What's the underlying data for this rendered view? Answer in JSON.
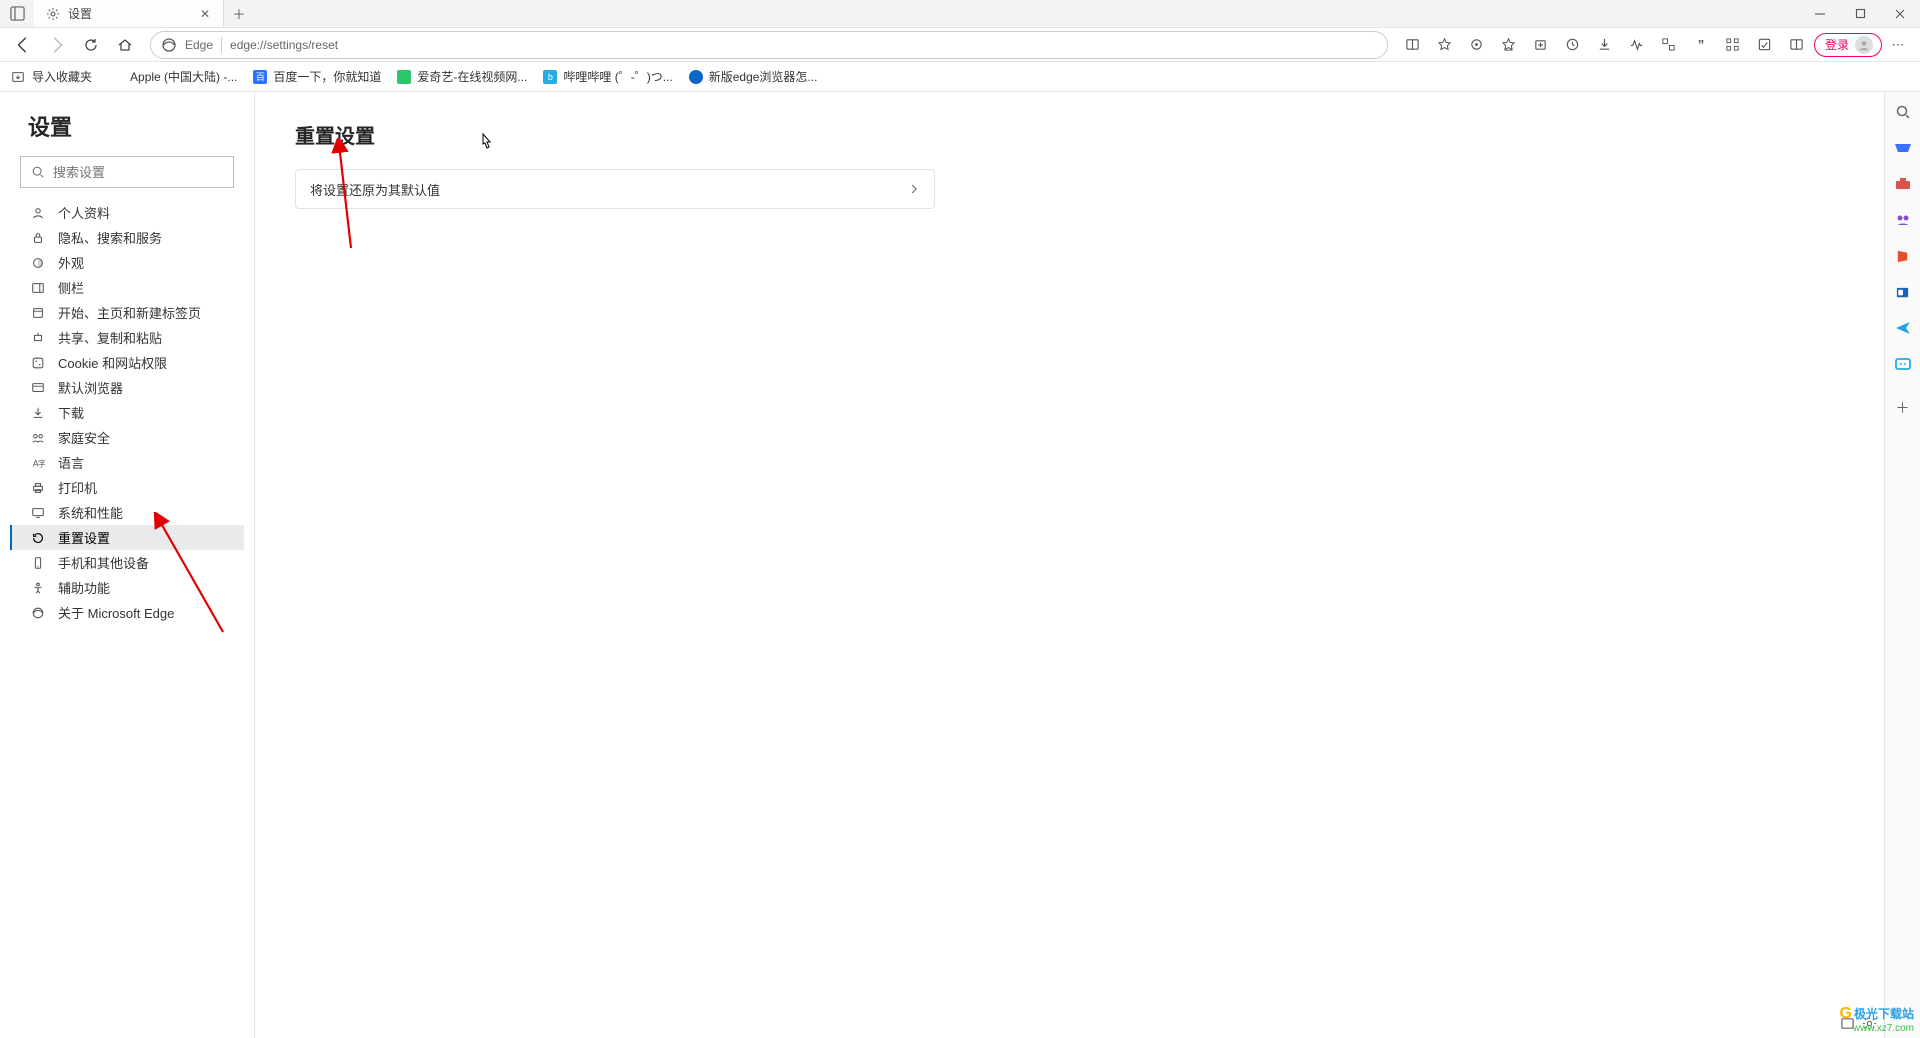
{
  "tab": {
    "title": "设置"
  },
  "address": {
    "brand": "Edge",
    "url": "edge://settings/reset"
  },
  "login_button": {
    "label": "登录"
  },
  "bookmarks": {
    "import": "导入收藏夹",
    "items": [
      {
        "label": "Apple (中国大陆) -...",
        "icon": "apple"
      },
      {
        "label": "百度一下，你就知道",
        "icon": "baidu"
      },
      {
        "label": "爱奇艺-在线视频网...",
        "icon": "iqiyi"
      },
      {
        "label": "哔哩哔哩 (゜-゜)つ...",
        "icon": "bili"
      },
      {
        "label": "新版edge浏览器怎...",
        "icon": "edge"
      }
    ]
  },
  "settings": {
    "title": "设置",
    "search_placeholder": "搜索设置",
    "nav": [
      {
        "label": "个人资料",
        "icon": "profile"
      },
      {
        "label": "隐私、搜索和服务",
        "icon": "lock"
      },
      {
        "label": "外观",
        "icon": "appearance"
      },
      {
        "label": "侧栏",
        "icon": "sidebar"
      },
      {
        "label": "开始、主页和新建标签页",
        "icon": "home"
      },
      {
        "label": "共享、复制和粘贴",
        "icon": "share"
      },
      {
        "label": "Cookie 和网站权限",
        "icon": "cookie"
      },
      {
        "label": "默认浏览器",
        "icon": "browser"
      },
      {
        "label": "下载",
        "icon": "download"
      },
      {
        "label": "家庭安全",
        "icon": "family"
      },
      {
        "label": "语言",
        "icon": "language"
      },
      {
        "label": "打印机",
        "icon": "printer"
      },
      {
        "label": "系统和性能",
        "icon": "system"
      },
      {
        "label": "重置设置",
        "icon": "reset",
        "active": true
      },
      {
        "label": "手机和其他设备",
        "icon": "phone"
      },
      {
        "label": "辅助功能",
        "icon": "accessibility"
      },
      {
        "label": "关于 Microsoft Edge",
        "icon": "edge"
      }
    ]
  },
  "main": {
    "heading": "重置设置",
    "reset_item_label": "将设置还原为其默认值"
  },
  "watermark": {
    "line1": "极光下载站",
    "line2": "www.xz7.com"
  }
}
